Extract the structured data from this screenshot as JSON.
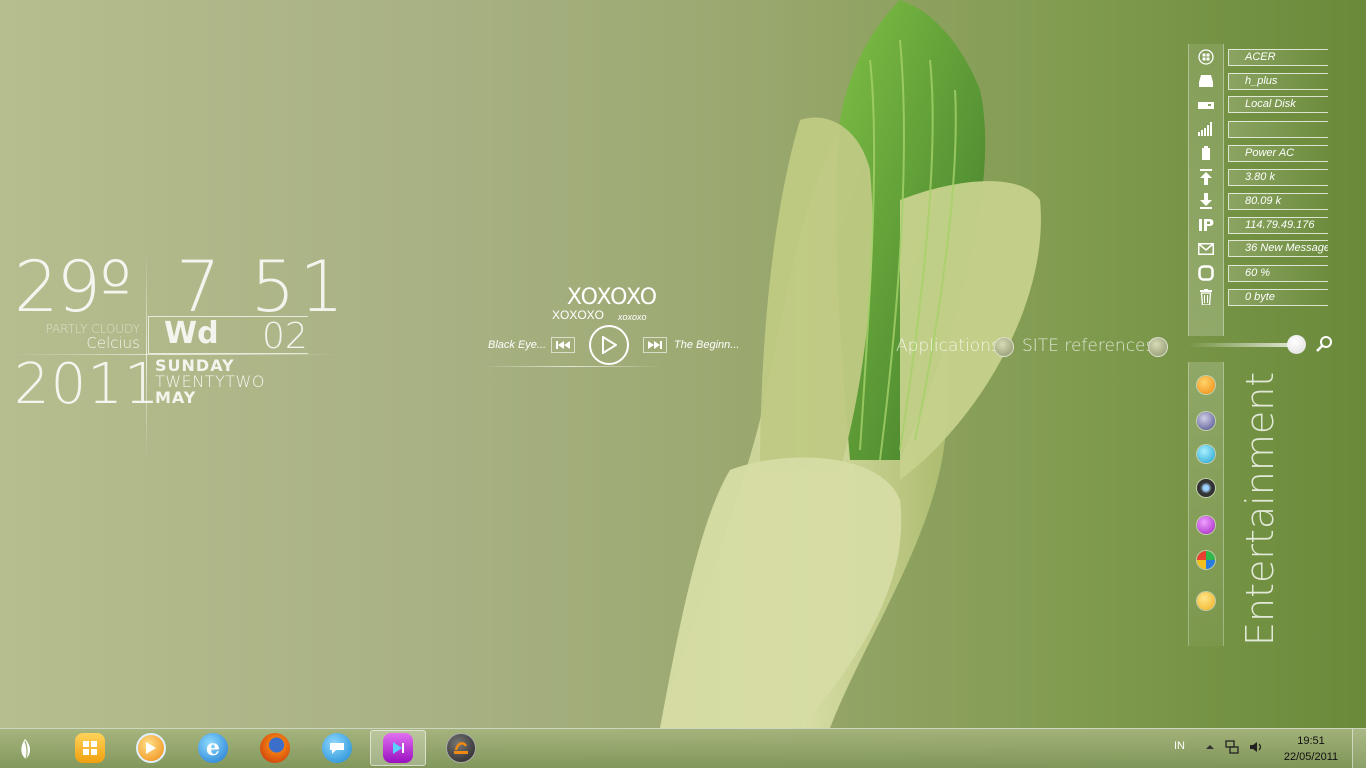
{
  "weather": {
    "temperature": "29º",
    "condition": "PARTLY CLOUDY",
    "unit": "Celcius"
  },
  "clock": {
    "time": "7 51",
    "weekday_abbr": "Wd",
    "day_number": "02",
    "year": "2011",
    "day_name": "SUNDAY",
    "day_words": "TWENTYTWO",
    "month": "MAY"
  },
  "media": {
    "title": "XOXOXO",
    "artist": "XOXOXO",
    "album": "xoxoxo",
    "prev_track": "Black Eye...",
    "next_track": "The Beginn..."
  },
  "launcher": {
    "apps_label": "Applications",
    "site_label": "SITE references"
  },
  "system": {
    "rows": [
      {
        "icon": "windows-icon",
        "value": "ACER"
      },
      {
        "icon": "drive-icon",
        "value": "h_plus"
      },
      {
        "icon": "disk-icon",
        "value": "Local Disk"
      },
      {
        "icon": "signal-icon",
        "value": ""
      },
      {
        "icon": "battery-icon",
        "value": "Power AC"
      },
      {
        "icon": "upload-icon",
        "value": "3.80 k"
      },
      {
        "icon": "download-icon",
        "value": "80.09 k"
      },
      {
        "icon": "ip-icon",
        "value": "114.79.49.176"
      },
      {
        "icon": "mail-icon",
        "value": "36 New Message"
      },
      {
        "icon": "memory-icon",
        "value": "60 %"
      },
      {
        "icon": "trash-icon",
        "value": "0 byte"
      }
    ]
  },
  "entertainment": {
    "label": "Entertainment",
    "icons": [
      "media-player-icon",
      "itunes-icon",
      "photo-gallery-icon",
      "webcam-icon",
      "music-icon",
      "media-center-icon",
      "yellow-app-icon"
    ]
  },
  "taskbar": {
    "items": [
      "file-explorer-icon",
      "media-player-icon",
      "internet-explorer-icon",
      "firefox-icon",
      "messenger-icon",
      "music-player-icon",
      "smart-app-icon"
    ],
    "tray_language": "IN",
    "clock_time": "19:51",
    "clock_date": "22/05/2011"
  },
  "colors": {
    "accent": "#7f9a4d",
    "bud": "#c9d08f",
    "leaf": "#6aa83a"
  }
}
